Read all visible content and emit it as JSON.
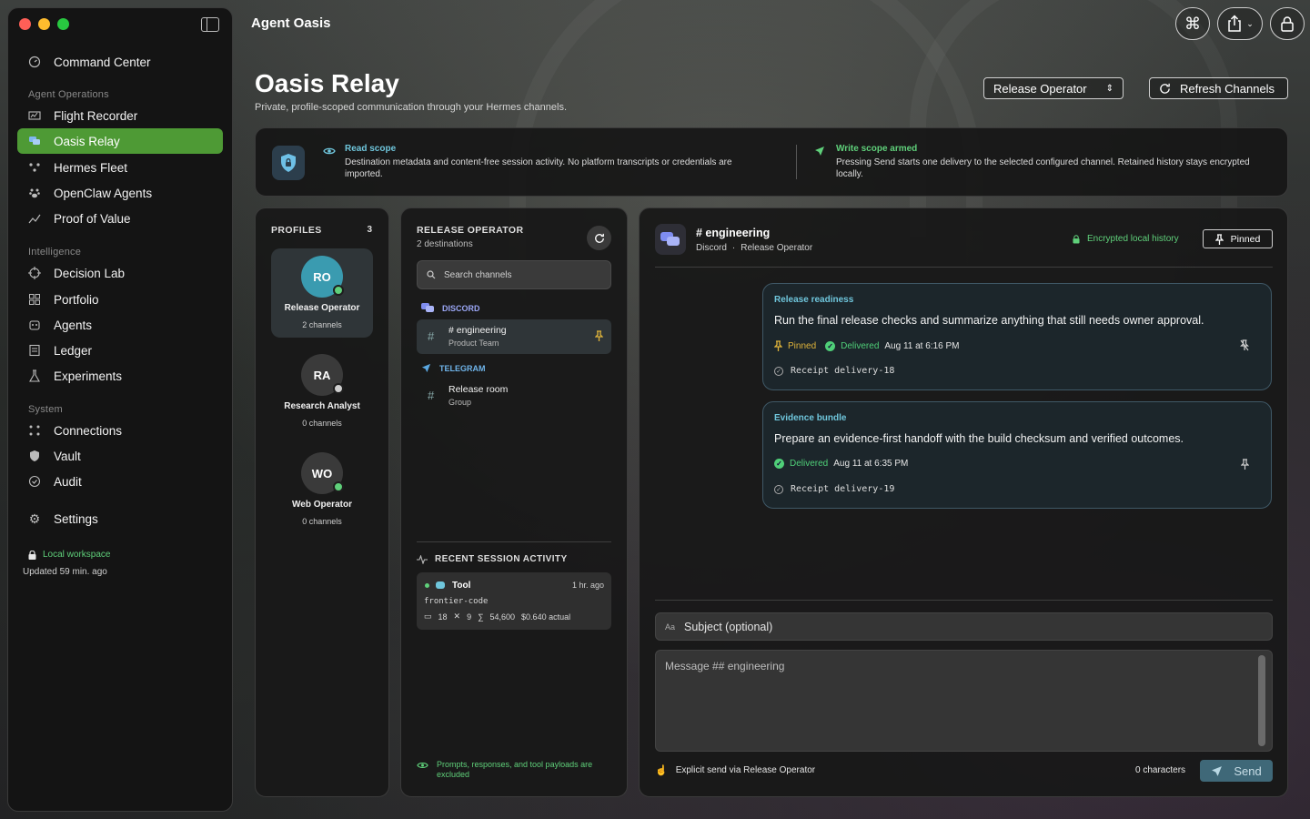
{
  "app": {
    "title": "Agent Oasis"
  },
  "sidebar": {
    "top": {
      "label": "Command Center"
    },
    "sections": [
      {
        "title": "Agent Operations",
        "items": [
          "Flight Recorder",
          "Oasis Relay",
          "Hermes Fleet",
          "OpenClaw Agents",
          "Proof of Value"
        ]
      },
      {
        "title": "Intelligence",
        "items": [
          "Decision Lab",
          "Portfolio",
          "Agents",
          "Ledger",
          "Experiments"
        ]
      },
      {
        "title": "System",
        "items": [
          "Connections",
          "Vault",
          "Audit"
        ]
      }
    ],
    "settings": "Settings",
    "workspace": "Local workspace",
    "updated": "Updated 59 min. ago",
    "active_item": "Oasis Relay"
  },
  "page": {
    "title": "Oasis Relay",
    "subtitle": "Private, profile-scoped communication through your Hermes channels.",
    "profile_select": "Release Operator",
    "refresh_label": "Refresh Channels"
  },
  "banner": {
    "read": {
      "title": "Read scope",
      "text": "Destination metadata and content-free session activity. No platform transcripts or credentials are imported."
    },
    "write": {
      "title": "Write scope armed",
      "text": "Pressing Send starts one delivery to the selected configured channel. Retained history stays encrypted locally."
    }
  },
  "profiles": {
    "label": "PROFILES",
    "count": "3",
    "items": [
      {
        "initials": "RO",
        "name": "Release Operator",
        "channels": "2 channels",
        "status": "online",
        "avatar_color": "#3a9bb0"
      },
      {
        "initials": "RA",
        "name": "Research Analyst",
        "channels": "0 channels",
        "status": "offline",
        "avatar_color": "#3a3a3a"
      },
      {
        "initials": "WO",
        "name": "Web Operator",
        "channels": "0 channels",
        "status": "online",
        "avatar_color": "#3a3a3a"
      }
    ]
  },
  "channels": {
    "title": "RELEASE OPERATOR",
    "subtitle": "2 destinations",
    "search_placeholder": "Search channels",
    "groups": [
      {
        "platform": "DISCORD",
        "items": [
          {
            "name": "# engineering",
            "sub": "Product Team",
            "pinned": true
          }
        ]
      },
      {
        "platform": "TELEGRAM",
        "items": [
          {
            "name": "Release room",
            "sub": "Group",
            "pinned": false
          }
        ]
      }
    ],
    "activity": {
      "label": "RECENT SESSION ACTIVITY",
      "kind": "Tool",
      "time": "1 hr. ago",
      "model": "frontier-code",
      "messages": "18",
      "tools": "9",
      "tokens": "54,600",
      "cost": "$0.640 actual"
    },
    "footer": "Prompts, responses, and tool payloads are excluded"
  },
  "conversation": {
    "title": "# engineering",
    "platform": "Discord",
    "profile": "Release Operator",
    "encrypted_label": "Encrypted local history",
    "pinned_label": "Pinned",
    "messages": [
      {
        "title": "Release readiness",
        "body": "Run the final release checks and summarize anything that still needs owner approval.",
        "pinned": "Pinned",
        "status": "Delivered",
        "time": "Aug 11 at 6:16 PM",
        "receipt": "Receipt delivery-18"
      },
      {
        "title": "Evidence bundle",
        "body": "Prepare an evidence-first handoff with the build checksum and verified outcomes.",
        "status": "Delivered",
        "time": "Aug 11 at 6:35 PM",
        "receipt": "Receipt delivery-19"
      }
    ],
    "subject_prefix": "Aa",
    "subject_placeholder": "Subject (optional)",
    "message_placeholder": "Message ## engineering",
    "explicit_send": "Explicit send via Release Operator",
    "char_count": "0 characters",
    "send_label": "Send"
  },
  "colors": {
    "accent_green": "#4e9a35",
    "cyan": "#6fc6dc",
    "pin_yellow": "#e0b43a",
    "delivered_green": "#4fcf78"
  },
  "icons": [
    "command-icon",
    "share-icon",
    "lock-icon",
    "refresh-icon",
    "shield-icon",
    "eye-icon",
    "send-icon",
    "search-icon",
    "hash-icon",
    "pin-icon",
    "check-icon"
  ]
}
